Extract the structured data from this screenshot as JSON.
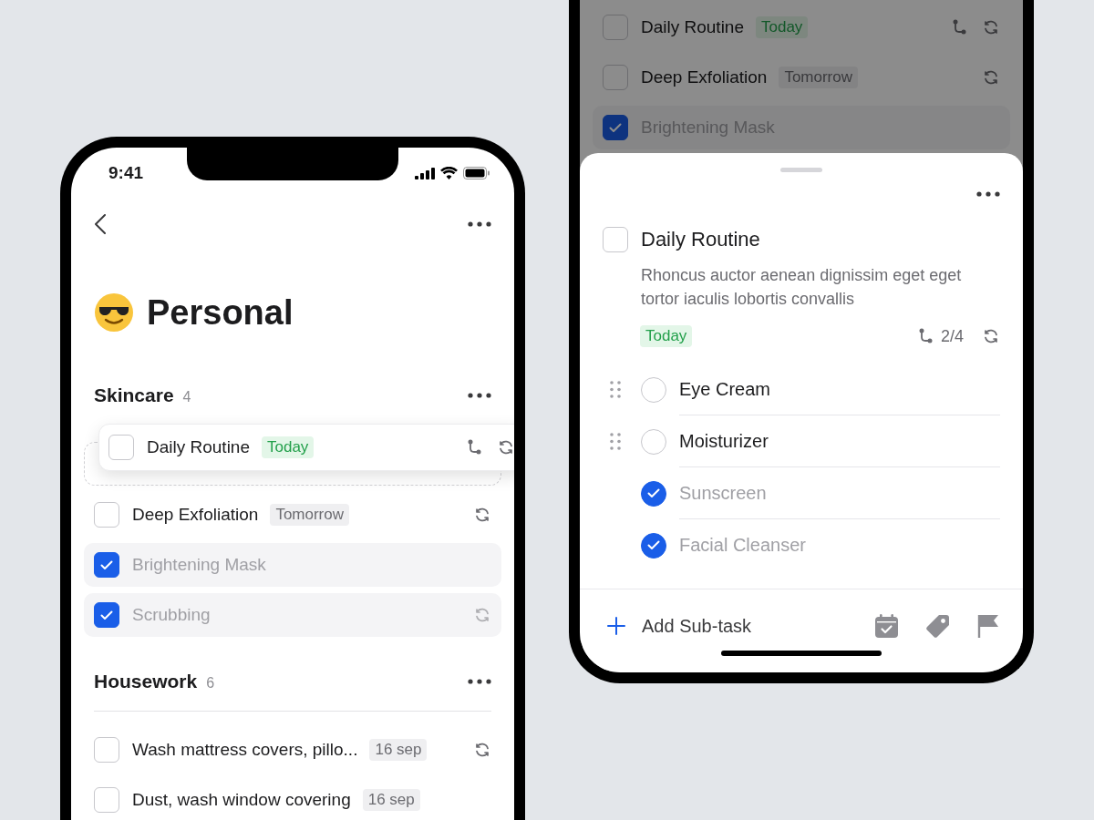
{
  "list_screen": {
    "status_bar": {
      "time": "9:41"
    },
    "title": "Personal",
    "groups": [
      {
        "name": "Skincare",
        "count": "4",
        "divider": false,
        "tasks": [
          {
            "title": "Daily Routine",
            "tag": {
              "text": "Today",
              "kind": "today"
            },
            "checked": false,
            "dragging": true,
            "has_subtasks": true,
            "repeat": true
          },
          {
            "title": "Deep Exfoliation",
            "tag": {
              "text": "Tomorrow",
              "kind": "date"
            },
            "checked": false,
            "dragging": false,
            "has_subtasks": false,
            "repeat": true
          },
          {
            "title": "Brightening Mask",
            "checked": true,
            "dragging": false,
            "has_subtasks": false,
            "repeat": false
          },
          {
            "title": "Scrubbing",
            "checked": true,
            "dragging": false,
            "has_subtasks": false,
            "repeat": true
          }
        ]
      },
      {
        "name": "Housework",
        "count": "6",
        "divider": true,
        "tasks": [
          {
            "title": "Wash mattress covers, pillo...",
            "tag": {
              "text": "16 sep",
              "kind": "date"
            },
            "checked": false,
            "dragging": false,
            "has_subtasks": false,
            "repeat": true
          },
          {
            "title": "Dust, wash window covering",
            "tag": {
              "text": "16 sep",
              "kind": "date"
            },
            "checked": false,
            "dragging": false,
            "has_subtasks": false,
            "repeat": false
          }
        ]
      }
    ]
  },
  "detail_screen": {
    "background_tasks": [
      {
        "title": "Daily Routine",
        "tag": {
          "text": "Today",
          "kind": "today"
        },
        "checked": false,
        "has_subtasks": true,
        "repeat": true
      },
      {
        "title": "Deep Exfoliation",
        "tag": {
          "text": "Tomorrow",
          "kind": "date"
        },
        "checked": false,
        "has_subtasks": false,
        "repeat": true
      },
      {
        "title": "Brightening Mask",
        "checked": true,
        "has_subtasks": false,
        "repeat": false
      }
    ],
    "sheet": {
      "title": "Daily Routine",
      "checked": false,
      "description": "Rhoncus auctor aenean dignissim eget eget tortor iaculis lobortis convallis",
      "tag": {
        "text": "Today",
        "kind": "today"
      },
      "subtask_progress": "2/4",
      "repeat": true,
      "subtasks": [
        {
          "title": "Eye Cream",
          "checked": false
        },
        {
          "title": "Moisturizer",
          "checked": false
        },
        {
          "title": "Sunscreen",
          "checked": true
        },
        {
          "title": "Facial Cleanser",
          "checked": true
        }
      ],
      "add_label": "Add Sub-task"
    }
  }
}
